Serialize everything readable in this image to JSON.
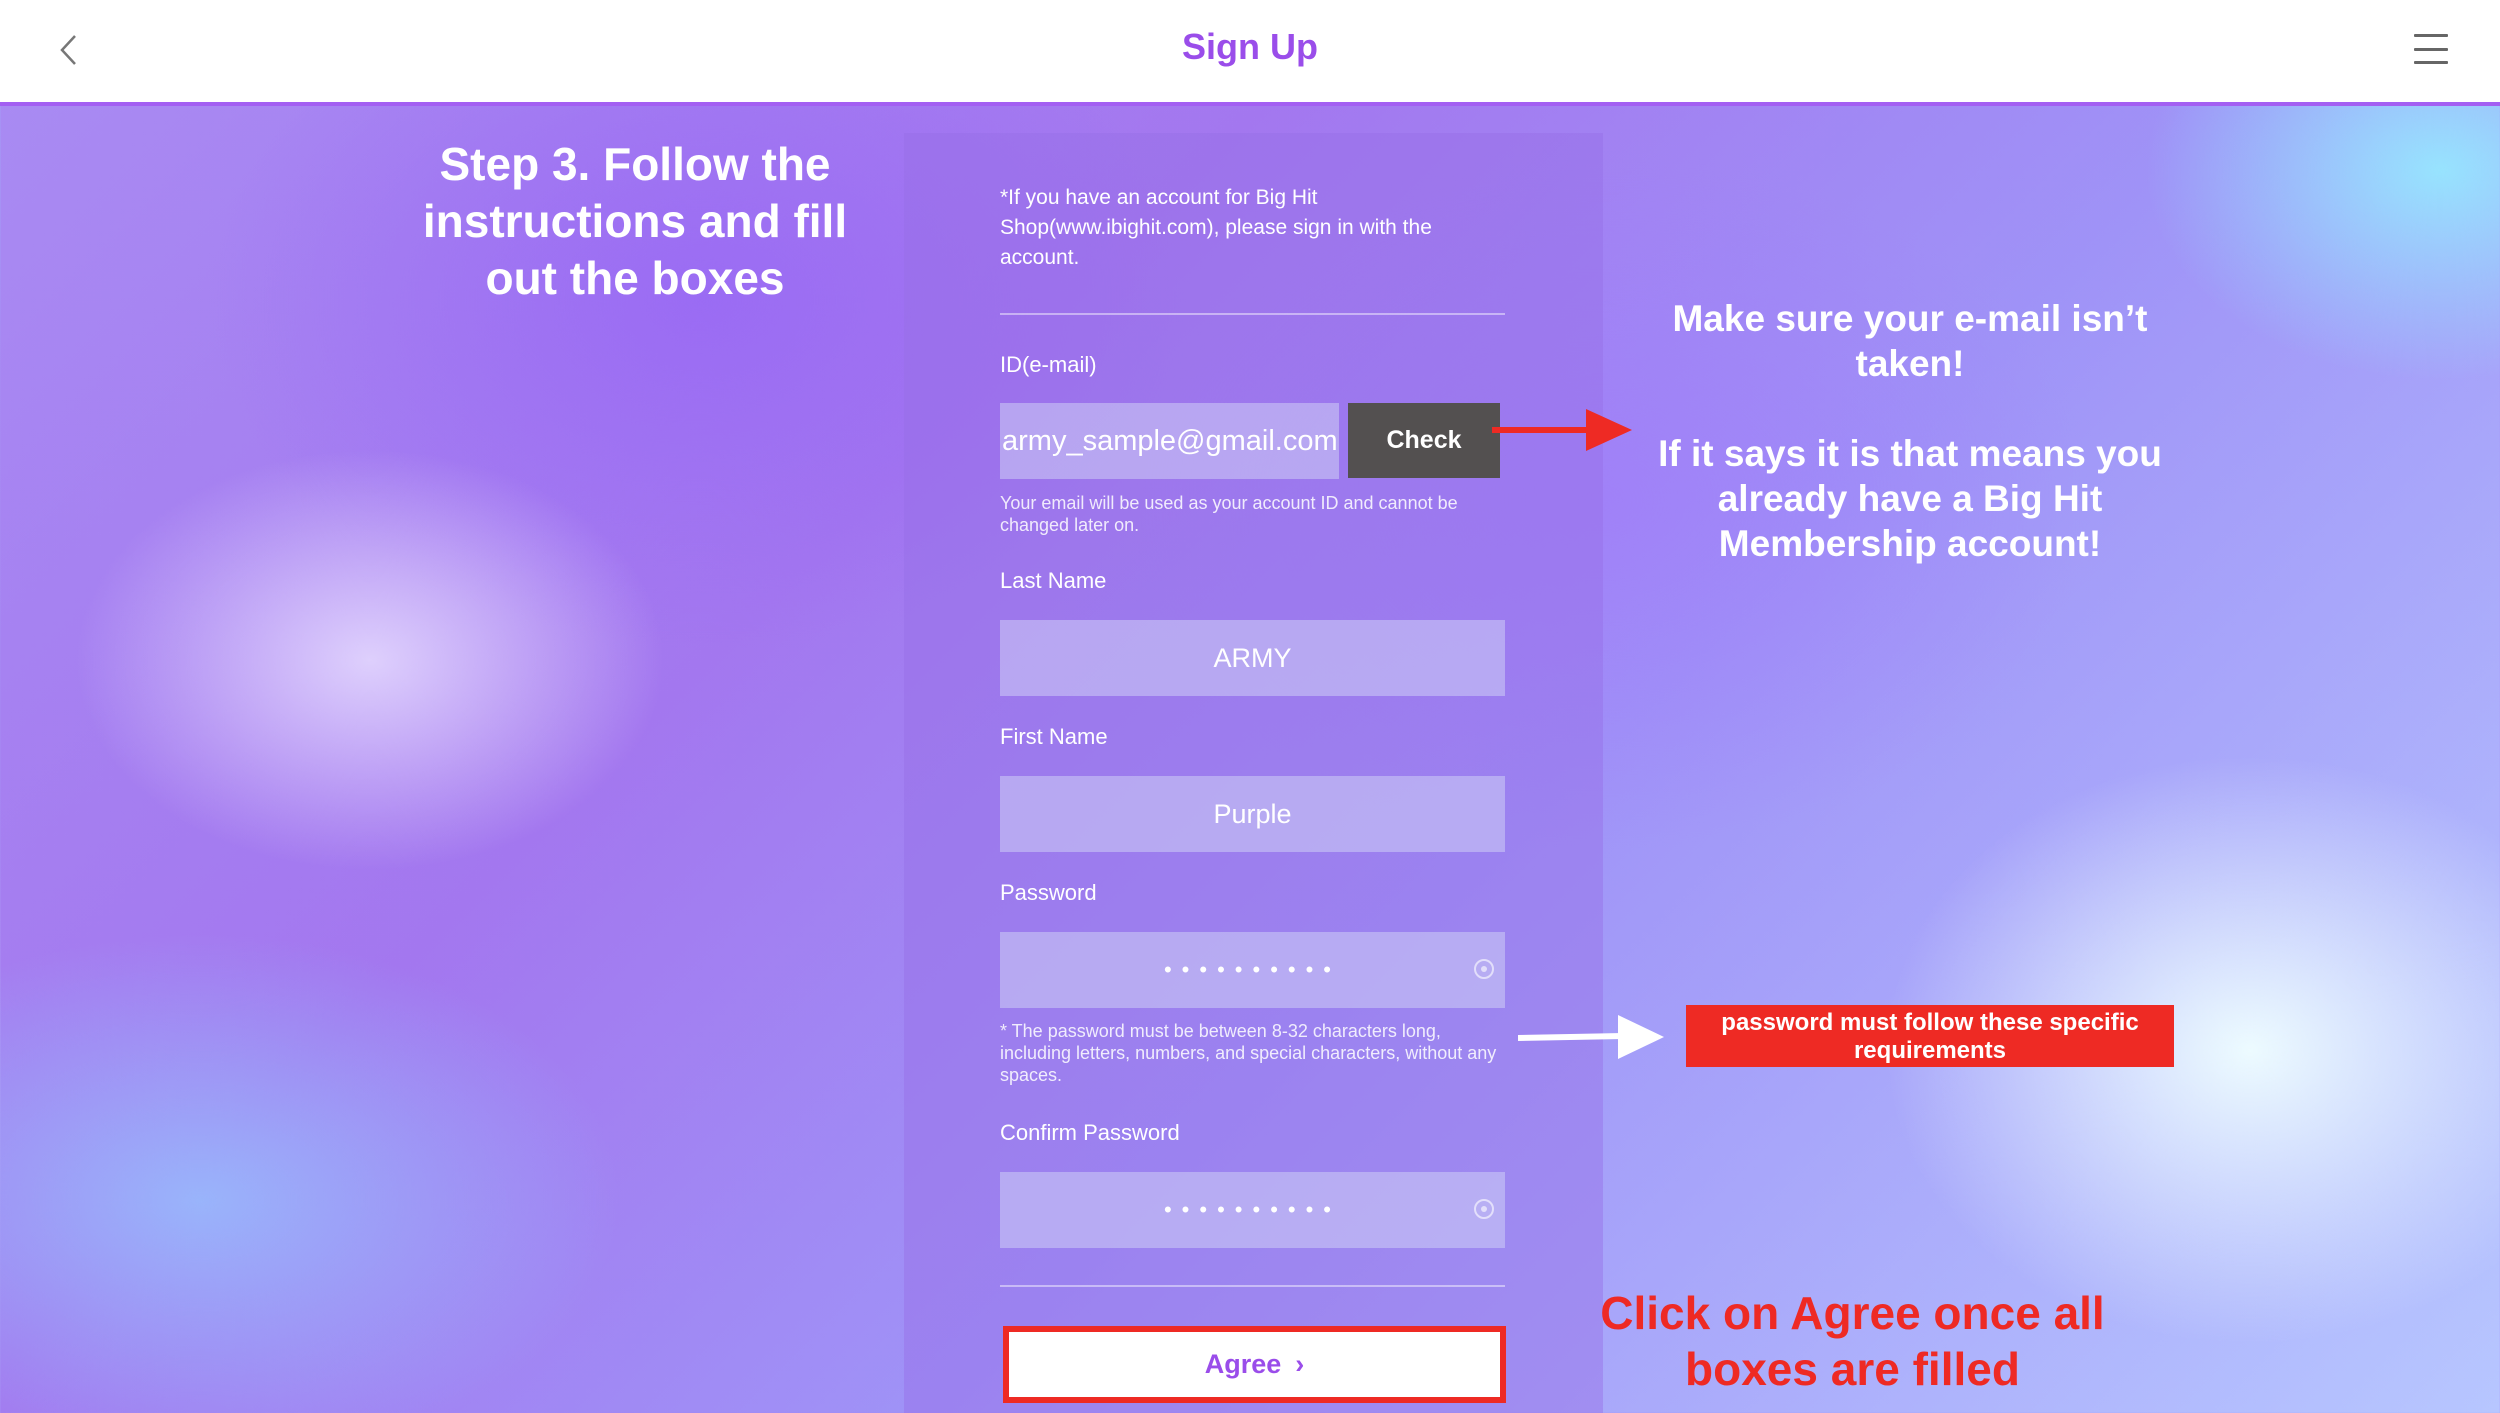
{
  "header": {
    "title": "Sign Up",
    "back_icon": "chevron-left-icon",
    "menu_icon": "hamburger-menu-icon"
  },
  "form": {
    "notice": "*If you have an account for Big Hit Shop(www.ibighit.com), please sign in with the account.",
    "email": {
      "label": "ID(e-mail)",
      "value": "army_sample@gmail.com",
      "check_label": "Check",
      "helper": "Your email will be used as your account ID and cannot be changed later on."
    },
    "last_name": {
      "label": "Last Name",
      "value": "ARMY"
    },
    "first_name": {
      "label": "First Name",
      "value": "Purple"
    },
    "password": {
      "label": "Password",
      "value": "••••••••••",
      "helper": "* The password must be between 8-32 characters long, including letters, numbers, and special characters, without any spaces."
    },
    "confirm_password": {
      "label": "Confirm Password",
      "value": "••••••••••"
    },
    "agree_label": "Agree",
    "agree_chevron": "›"
  },
  "annotations": {
    "step": "Step 3. Follow the instructions and fill out the boxes",
    "email_note_1": "Make sure your e-mail isn’t taken!",
    "email_note_2": "If it says it is that means you already have a Big Hit Membership account!",
    "password_note": "password must follow these specific requirements",
    "agree_note": "Click on Agree once all boxes are filled"
  },
  "colors": {
    "accent_purple": "#9a4dea",
    "annotation_red": "#ee2a24",
    "check_button": "#535050"
  }
}
